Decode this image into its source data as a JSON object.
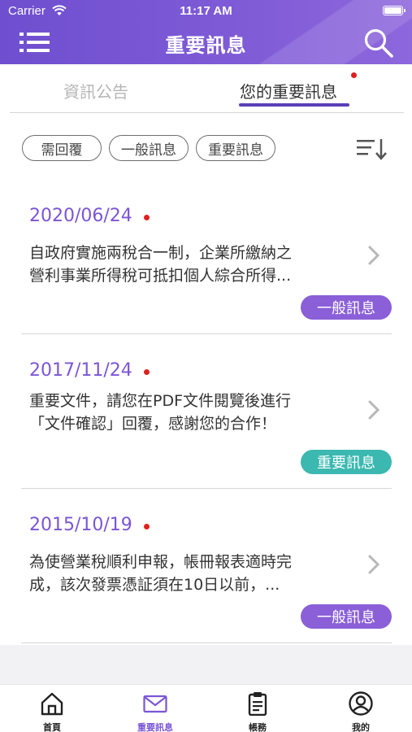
{
  "status_bar": {
    "carrier": "Carrier",
    "time": "11:17 AM"
  },
  "header": {
    "title": "重要訊息"
  },
  "tabs": [
    {
      "label": "資訊公告",
      "active": false
    },
    {
      "label": "您的重要訊息",
      "active": true
    }
  ],
  "filters": [
    {
      "label": "需回覆"
    },
    {
      "label": "一般訊息"
    },
    {
      "label": "重要訊息"
    }
  ],
  "messages": [
    {
      "date": "2020/06/24",
      "line1": "自政府實施兩稅合一制，企業所繳納之",
      "line2": "營利事業所得稅可抵扣個人綜合所得...",
      "badge": "一般訊息",
      "badge_color": "#8a5fd8"
    },
    {
      "date": "2017/11/24",
      "line1": "重要文件，請您在PDF文件閱覽後進行",
      "line2": "「文件確認」回覆，感謝您的合作！",
      "badge": "重要訊息",
      "badge_color": "#3bb8b0"
    },
    {
      "date": "2015/10/19",
      "line1": "為使營業稅順利申報，帳冊報表適時完",
      "line2": "成，該次發票憑証須在10日以前，...",
      "badge": "一般訊息",
      "badge_color": "#8a5fd8"
    }
  ],
  "bottom_nav": [
    {
      "label": "首頁",
      "icon": "home-icon",
      "active": false
    },
    {
      "label": "重要訊息",
      "icon": "mail-icon",
      "active": true
    },
    {
      "label": "帳務",
      "icon": "clipboard-icon",
      "active": false
    },
    {
      "label": "我的",
      "icon": "user-icon",
      "active": false
    }
  ],
  "colors": {
    "accent": "#7b55d6",
    "unread_dot": "#e02020",
    "teal_badge": "#3bb8b0"
  }
}
